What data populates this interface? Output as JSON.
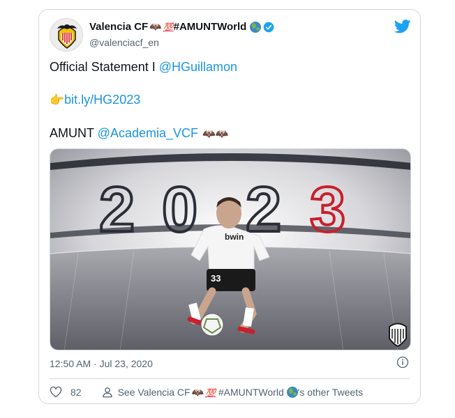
{
  "tweet": {
    "display_name": "Valencia CF",
    "bat_emoji": "🦇",
    "hundred_emoji": "💯",
    "hashtag_name": " #AMUNTWorld",
    "handle": "@valenciacf_en",
    "line1_prefix": "Official Statement I ",
    "line1_mention": "@HGuillamon",
    "point_emoji": "👉",
    "link": "bit.ly/HG2023",
    "line3_prefix": "AMUNT ",
    "line3_mention": "@Academia_VCF",
    "line3_bats": "🦇🦇",
    "image": {
      "big_text": "2023",
      "shirt_sponsor": "bwin",
      "shirt_number": "33"
    },
    "timestamp": "12:50 AM · Jul 23, 2020",
    "likes": "82",
    "see_prefix": "See Valencia CF",
    "see_suffix": " #AMUNTWorld ",
    "see_tail": "'s other Tweets"
  },
  "icons": {
    "brand": "twitter-bird-icon",
    "verified": "verified-badge-icon",
    "info": "info-icon",
    "like": "heart-icon",
    "profile": "person-icon"
  },
  "colors": {
    "link": "#1b95e0",
    "twitter_blue": "#1da1f2",
    "muted": "#536471",
    "border": "#cfd9de"
  }
}
